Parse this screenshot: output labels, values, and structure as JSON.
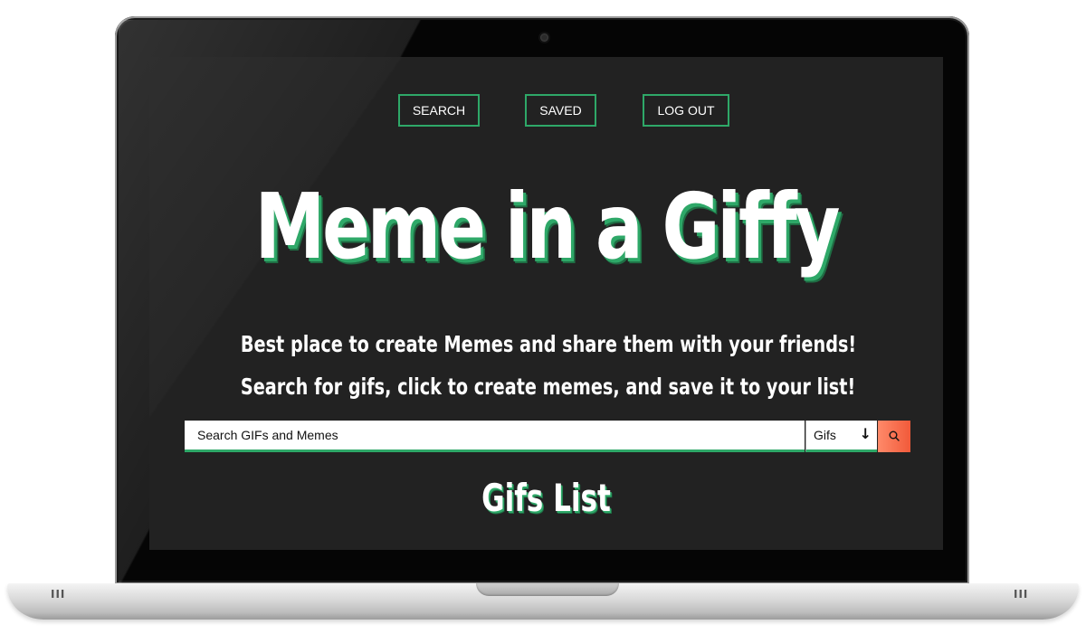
{
  "nav": {
    "search_label": "SEARCH",
    "saved_label": "SAVED",
    "logout_label": "LOG OUT"
  },
  "hero": {
    "title": "Meme in a Giffy",
    "tagline_1": "Best place to create Memes and share them with your friends!",
    "tagline_2": "Search for gifs, click to create memes, and save it to your list!"
  },
  "search": {
    "placeholder": "Search GIFs and Memes",
    "type_selected": "Gifs",
    "button_icon": "search-icon"
  },
  "list": {
    "title": "Gifs List"
  },
  "colors": {
    "background": "#222222",
    "accent_green": "#2ea868",
    "search_button": "#f15a3a"
  },
  "device": {
    "vent_glyph": "III"
  }
}
